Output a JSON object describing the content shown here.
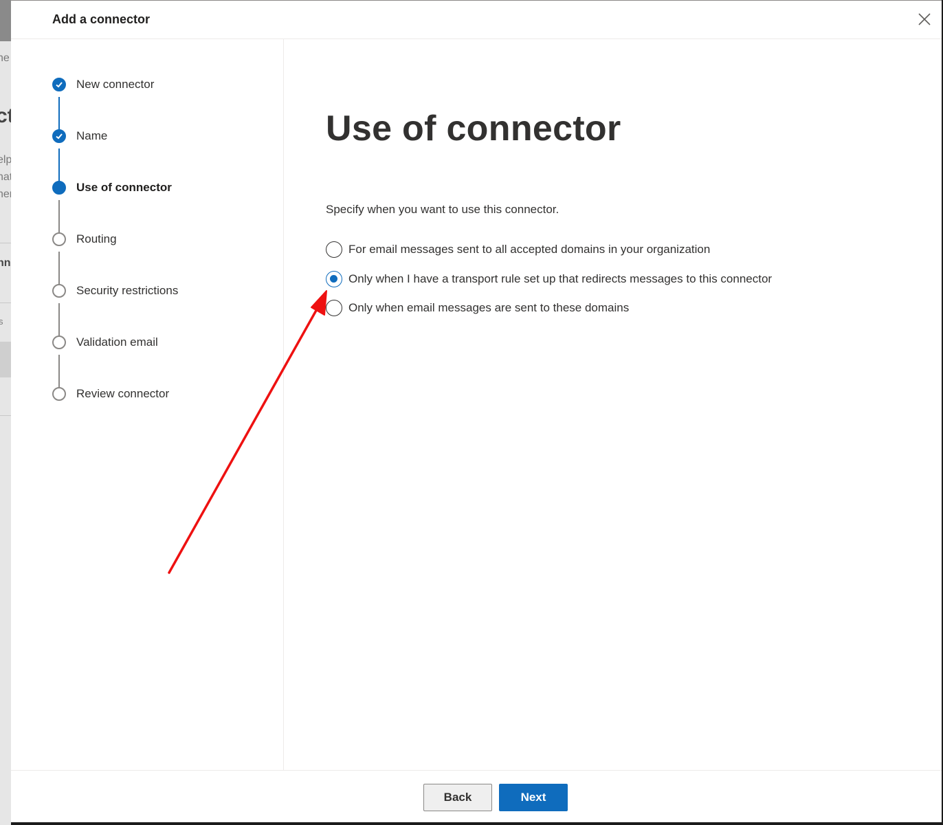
{
  "background": {
    "fragments": [
      "ne",
      "ct",
      "elp",
      "nat",
      "ner",
      "nn",
      "s"
    ]
  },
  "panel": {
    "title": "Add a connector",
    "close_icon": "close-icon"
  },
  "steps": [
    {
      "label": "New connector",
      "status": "done"
    },
    {
      "label": "Name",
      "status": "done"
    },
    {
      "label": "Use of connector",
      "status": "current"
    },
    {
      "label": "Routing",
      "status": "todo"
    },
    {
      "label": "Security restrictions",
      "status": "todo"
    },
    {
      "label": "Validation email",
      "status": "todo"
    },
    {
      "label": "Review connector",
      "status": "todo"
    }
  ],
  "main": {
    "title": "Use of connector",
    "description": "Specify when you want to use this connector.",
    "options": [
      {
        "label": "For email messages sent to all accepted domains in your organization",
        "checked": false
      },
      {
        "label": "Only when I have a transport rule set up that redirects messages to this connector",
        "checked": true
      },
      {
        "label": "Only when email messages are sent to these domains",
        "checked": false
      }
    ]
  },
  "footer": {
    "back_label": "Back",
    "next_label": "Next"
  },
  "annotation": {
    "arrow_color": "#ee1111"
  },
  "colors": {
    "accent": "#0f6cbd",
    "text": "#323130"
  }
}
